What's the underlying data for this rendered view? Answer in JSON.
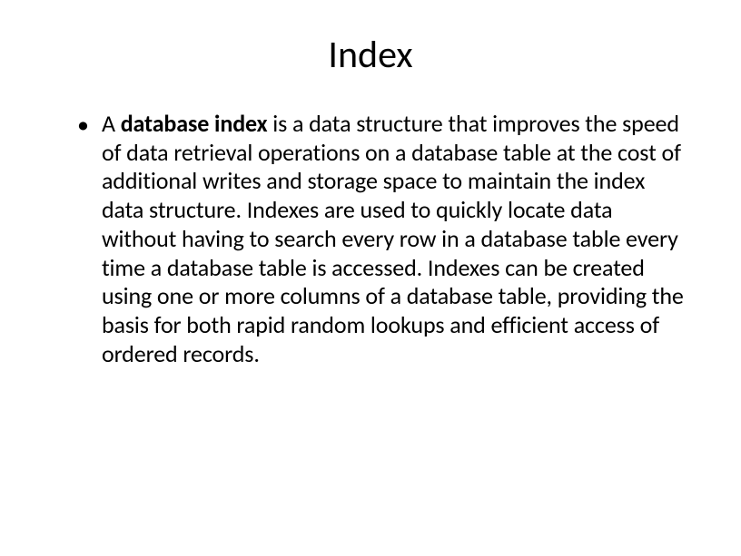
{
  "slide": {
    "title": "Index",
    "bullet1": {
      "prefix": "A ",
      "bold_term": "database index",
      "rest": " is a data structure that improves the speed of data retrieval operations on a database table at the cost of additional writes and storage space to maintain the index data structure. Indexes are used to quickly locate data without having to search every row in a database table every time a database table is accessed. Indexes can be created using one or more columns of a database table, providing the basis for both rapid random lookups and efficient access of ordered records."
    }
  }
}
